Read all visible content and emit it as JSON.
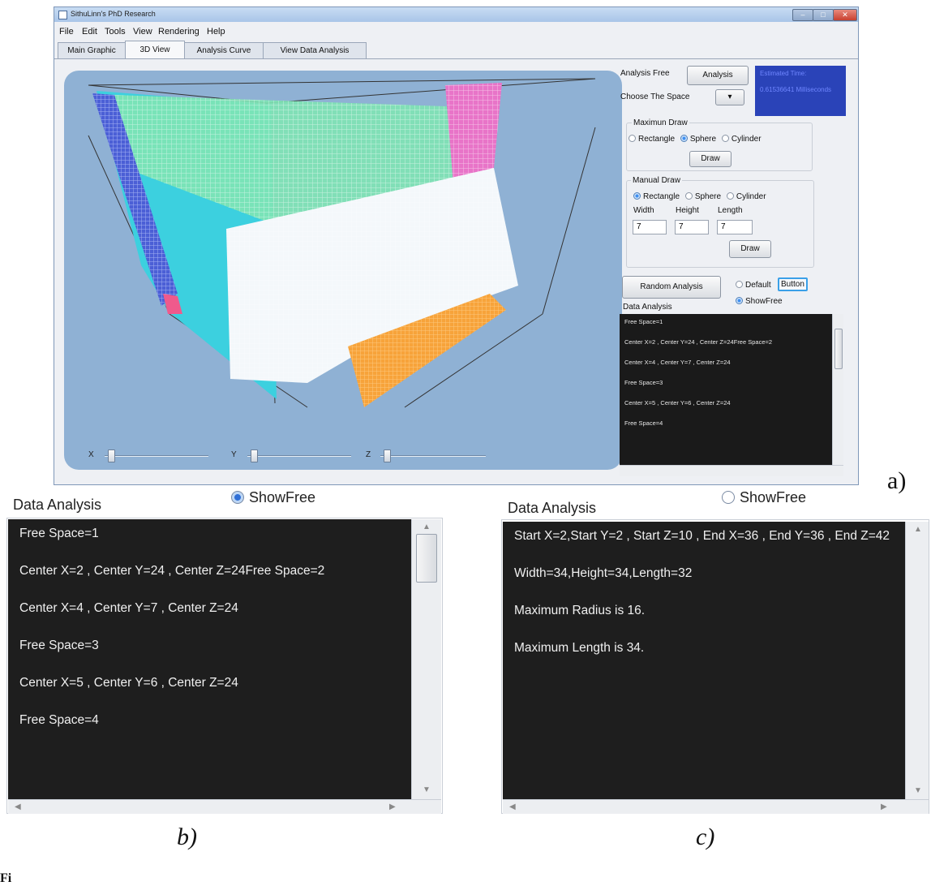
{
  "window": {
    "title": "SithuLinn's PhD Research",
    "menu": [
      "File",
      "Edit",
      "Tools",
      "View",
      "Rendering",
      "Help"
    ],
    "tabs": [
      "Main Graphic",
      "3D View",
      "Analysis Curve",
      "View Data Analysis"
    ],
    "active_tab": "3D View"
  },
  "sliders": {
    "x_label": "X",
    "y_label": "Y",
    "z_label": "Z"
  },
  "controls": {
    "analysis_free_label": "Analysis Free",
    "analysis_button": "Analysis",
    "choose_space_label": "Choose The Space",
    "info_box_line1": "Estimated Time:",
    "info_box_line2": "0.61536641 Milliseconds",
    "maximum_draw": {
      "title": "Maximun Draw",
      "options": [
        "Rectangle",
        "Sphere",
        "Cylinder"
      ],
      "selected": "Sphere",
      "draw_button": "Draw"
    },
    "manual_draw": {
      "title": "Manual Draw",
      "options": [
        "Rectangle",
        "Sphere",
        "Cylinder"
      ],
      "selected": "Rectangle",
      "width_label": "Width",
      "height_label": "Height",
      "length_label": "Length",
      "width_value": "7",
      "height_value": "7",
      "length_value": "7",
      "draw_button": "Draw"
    },
    "random_analysis_button": "Random Analysis",
    "default_label": "Default",
    "button_label": "Button",
    "showfree_label": "ShowFree",
    "data_analysis_label": "Data Analysis"
  },
  "data_analysis_lines": [
    "Free Space=1",
    "Center X=2 , Center Y=24 , Center Z=24Free Space=2",
    "Center X=4 , Center Y=7 , Center Z=24",
    "Free Space=3",
    "Center X=5 , Center Y=6 , Center Z=24",
    "Free Space=4"
  ],
  "panel_b": {
    "title": "Data Analysis",
    "showfree_label": "ShowFree",
    "lines": [
      "Free Space=1",
      "Center X=2 , Center Y=24 , Center Z=24Free Space=2",
      "Center X=4 , Center Y=7 , Center Z=24",
      "Free Space=3",
      "Center X=5 , Center Y=6 , Center Z=24",
      "Free Space=4"
    ]
  },
  "panel_c": {
    "title": "Data Analysis",
    "showfree_label": "ShowFree",
    "lines": [
      "Start X=2,Start Y=2 , Start Z=10 , End X=36 , End Y=36 , End Z=42",
      "Width=34,Height=34,Length=32",
      "Maximum Radius is  16.",
      "Maximum Length is  34."
    ]
  },
  "captions": {
    "a": "a)",
    "b": "b)",
    "c": "c)",
    "fig": "Fi"
  },
  "colors": {
    "viewport_bg": "#8fb1d4",
    "terminal_bg": "#1e1e1e",
    "info_box_bg": "#2a43b8"
  }
}
